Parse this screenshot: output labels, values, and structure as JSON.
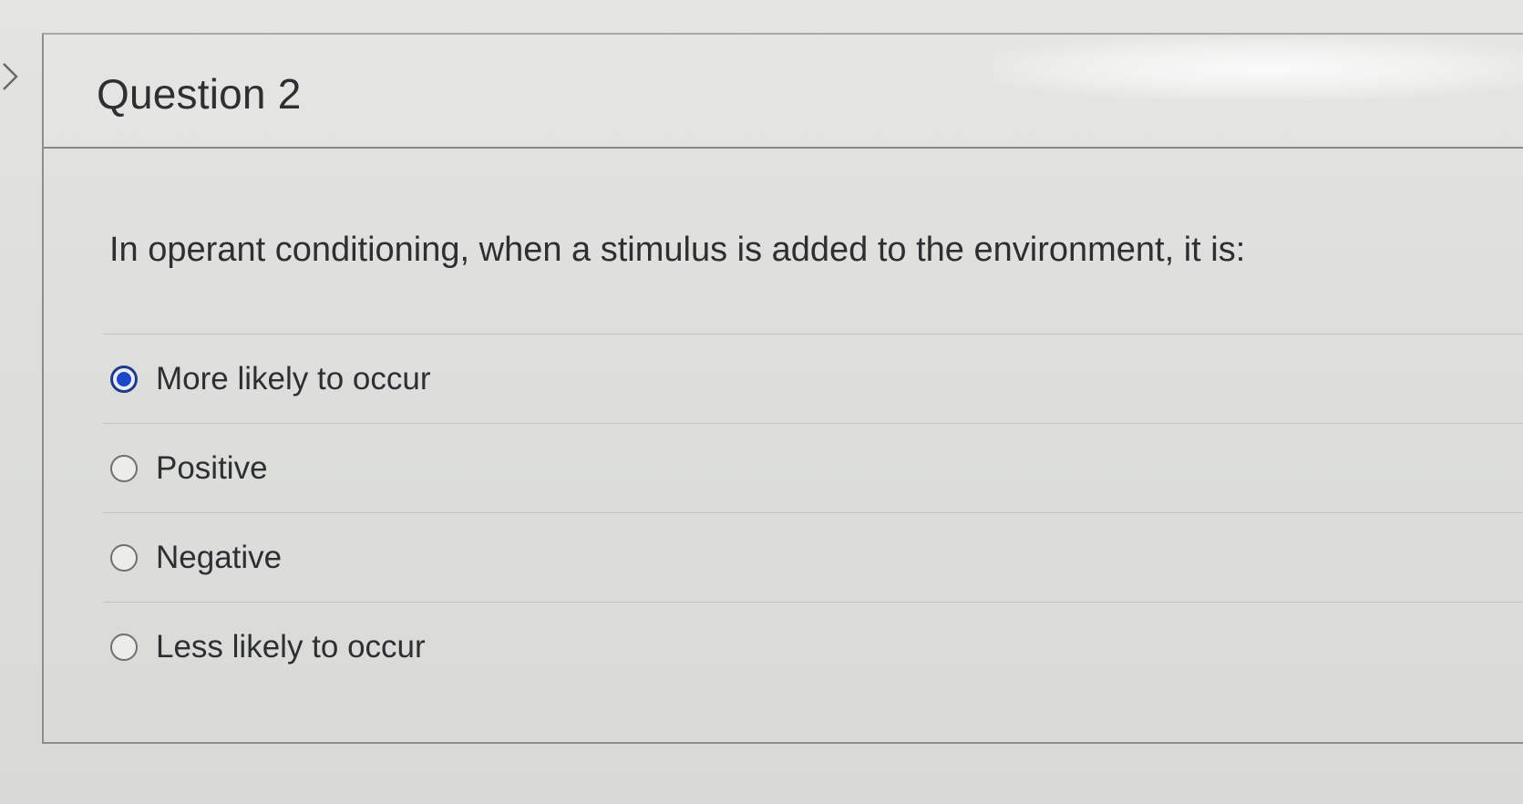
{
  "question": {
    "title": "Question 2",
    "text": "In operant conditioning, when a stimulus is added to the environment, it is:",
    "selected_index": 0,
    "answers": [
      {
        "label": "More likely to occur",
        "selected": true
      },
      {
        "label": "Positive",
        "selected": false
      },
      {
        "label": "Negative",
        "selected": false
      },
      {
        "label": "Less likely to occur",
        "selected": false
      }
    ]
  },
  "icons": {
    "left_nav": "chevron-right-icon"
  },
  "colors": {
    "radio_selected": "#1d47c9",
    "text": "#2d2f32"
  }
}
